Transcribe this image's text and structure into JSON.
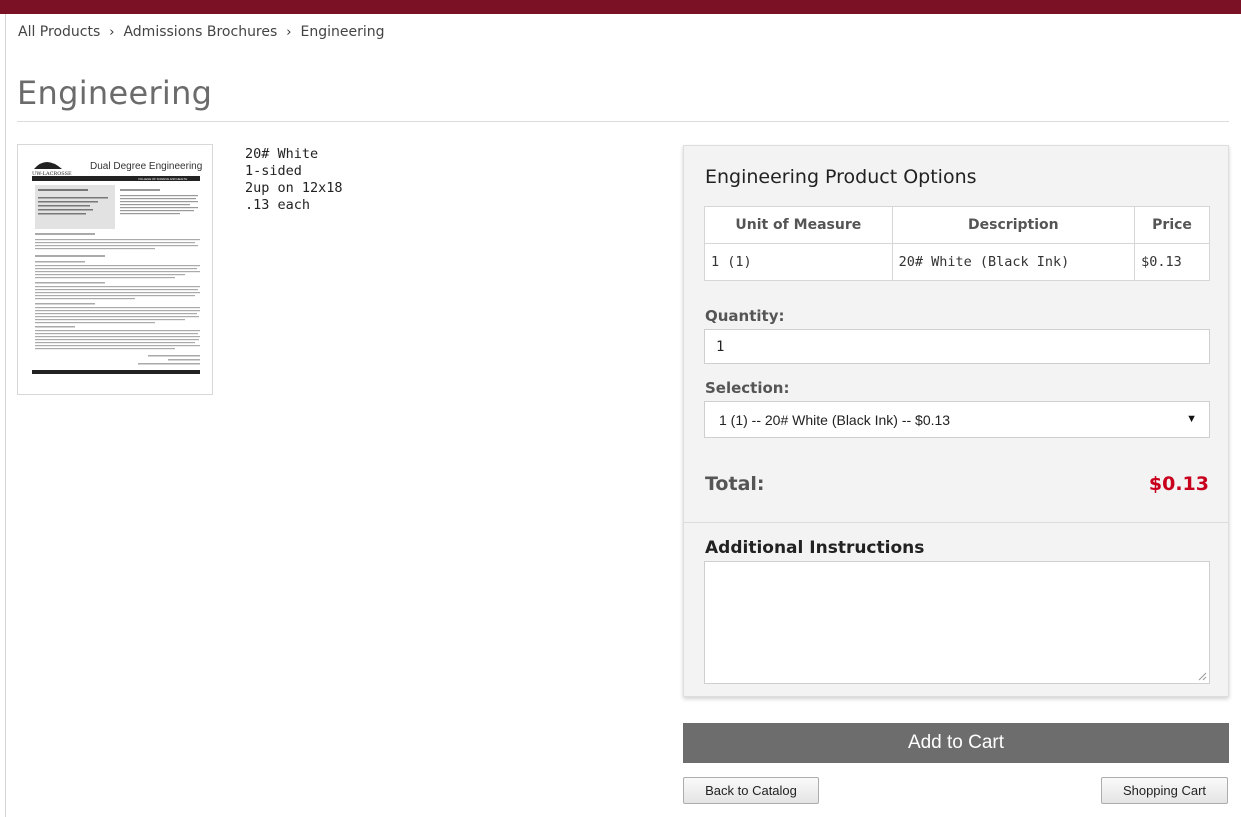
{
  "breadcrumb": {
    "items": [
      "All Products",
      "Admissions Brochures",
      "Engineering"
    ],
    "separator": "›"
  },
  "page_title": "Engineering",
  "thumbnail": {
    "logo_text": "UW-LACROSSE",
    "doc_title": "Dual Degree Engineering",
    "band_text": "COLLEGE OF SCIENCE AND HEALTH"
  },
  "specs": [
    "20# White",
    "1-sided",
    "2up on 12x18",
    ".13 each"
  ],
  "options_panel": {
    "title": "Engineering Product Options",
    "table": {
      "headers": [
        "Unit of Measure",
        "Description",
        "Price"
      ],
      "rows": [
        [
          "1 (1)",
          "20# White (Black Ink)",
          "$0.13"
        ]
      ]
    },
    "quantity": {
      "label": "Quantity:",
      "value": "1"
    },
    "selection": {
      "label": "Selection:",
      "value": "1 (1) -- 20# White (Black Ink) -- $0.13",
      "icon": "caret-down-icon"
    },
    "total": {
      "label": "Total:",
      "value": "$0.13",
      "color": "#c8001e"
    },
    "instructions": {
      "label": "Additional Instructions",
      "value": ""
    }
  },
  "actions": {
    "add_to_cart": "Add to Cart",
    "back_to_catalog": "Back to Catalog",
    "shopping_cart": "Shopping Cart"
  },
  "colors": {
    "brand": "#7a1124",
    "button": "#6d6d6d",
    "total": "#c8001e"
  }
}
